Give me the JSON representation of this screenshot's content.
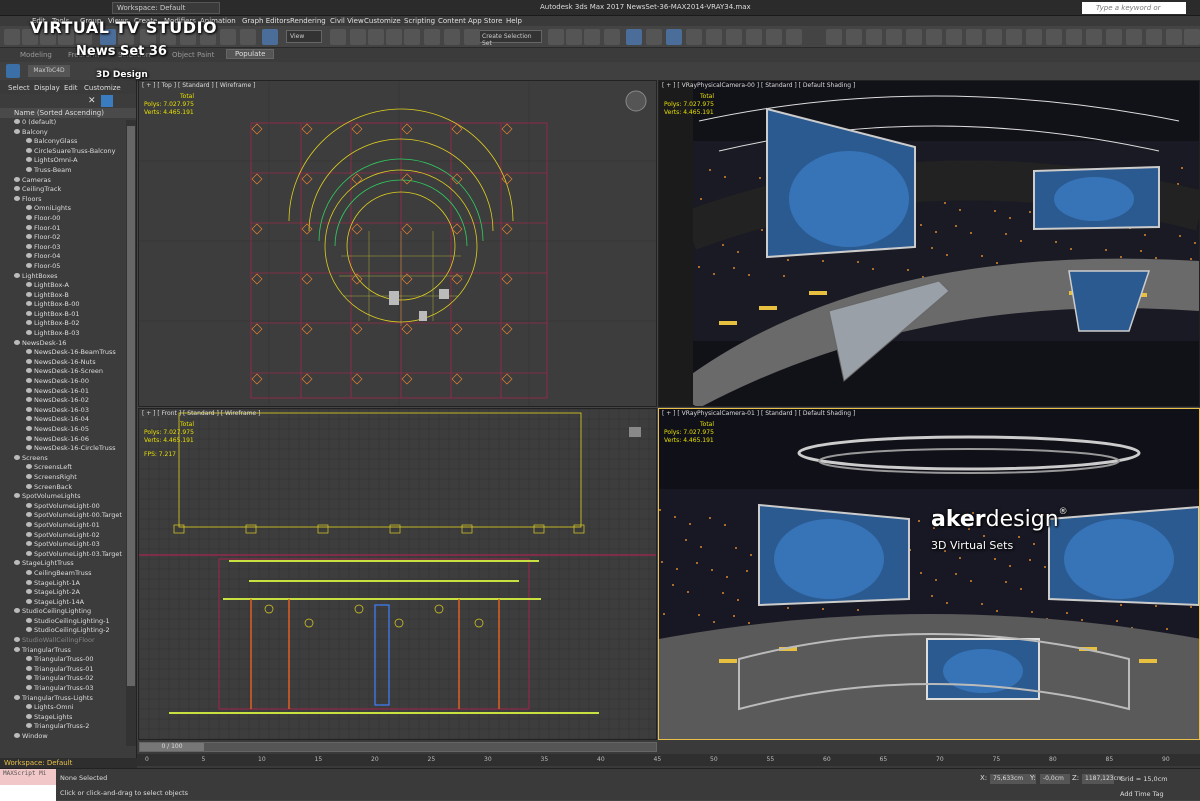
{
  "window": {
    "app_title": "Autodesk 3ds Max 2017      NewsSet-36-MAX2014-VRAY34.max",
    "workspace": "Workspace: Default",
    "search_placeholder": "Type a keyword or phrase"
  },
  "menu": [
    "Edit",
    "Tools",
    "Group",
    "Views",
    "Create",
    "Modifiers",
    "Animation",
    "Graph Editors",
    "Rendering",
    "Civil View",
    "Customize",
    "Scripting",
    "Content",
    "App Store",
    "Help"
  ],
  "toolbar": {
    "view_select": "View",
    "selection_set": "Create Selection Set"
  },
  "ribbon": {
    "tabs": [
      "Modeling",
      "Freeform",
      "Selection",
      "Object Paint",
      "Populate"
    ]
  },
  "maxtoc4d": "MaxToC4D",
  "brand": {
    "line1": "VIRTUAL TV STUDIO",
    "line2": "News Set 36",
    "line3": "3D Design",
    "logo_a": "aker",
    "logo_b": "design",
    "logo_mark": "®",
    "logo_sub": "3D Virtual Sets"
  },
  "scene_explorer": {
    "menu": [
      "Select",
      "Display",
      "Edit",
      "Customize"
    ],
    "close_glyph": "✕",
    "header": "Name (Sorted Ascending)",
    "items": [
      {
        "label": "0 (default)",
        "level": 1
      },
      {
        "label": "Balcony",
        "level": 1
      },
      {
        "label": "BalconyGlass",
        "level": 2
      },
      {
        "label": "CircleSuareTruss-Balcony",
        "level": 2
      },
      {
        "label": "LightsOmni-A",
        "level": 2
      },
      {
        "label": "Truss-Beam",
        "level": 2
      },
      {
        "label": "Cameras",
        "level": 1
      },
      {
        "label": "CeilingTrack",
        "level": 1
      },
      {
        "label": "Floors",
        "level": 1
      },
      {
        "label": "OmniLights",
        "level": 2
      },
      {
        "label": "Floor-00",
        "level": 2
      },
      {
        "label": "Floor-01",
        "level": 2
      },
      {
        "label": "Floor-02",
        "level": 2
      },
      {
        "label": "Floor-03",
        "level": 2
      },
      {
        "label": "Floor-04",
        "level": 2
      },
      {
        "label": "Floor-05",
        "level": 2
      },
      {
        "label": "LightBoxes",
        "level": 1
      },
      {
        "label": "LightBox-A",
        "level": 2
      },
      {
        "label": "LightBox-B",
        "level": 2
      },
      {
        "label": "LightBox-B-00",
        "level": 2
      },
      {
        "label": "LightBox-B-01",
        "level": 2
      },
      {
        "label": "LightBox-B-02",
        "level": 2
      },
      {
        "label": "LightBox-B-03",
        "level": 2
      },
      {
        "label": "NewsDesk-16",
        "level": 1
      },
      {
        "label": "NewsDesk-16-BeamTruss",
        "level": 2
      },
      {
        "label": "NewsDesk-16-Nuts",
        "level": 2
      },
      {
        "label": "NewsDesk-16-Screen",
        "level": 2
      },
      {
        "label": "NewsDesk-16-00",
        "level": 2
      },
      {
        "label": "NewsDesk-16-01",
        "level": 2
      },
      {
        "label": "NewsDesk-16-02",
        "level": 2
      },
      {
        "label": "NewsDesk-16-03",
        "level": 2
      },
      {
        "label": "NewsDesk-16-04",
        "level": 2
      },
      {
        "label": "NewsDesk-16-05",
        "level": 2
      },
      {
        "label": "NewsDesk-16-06",
        "level": 2
      },
      {
        "label": "NewsDesk-16-CircleTruss",
        "level": 2
      },
      {
        "label": "Screens",
        "level": 1
      },
      {
        "label": "ScreensLeft",
        "level": 2
      },
      {
        "label": "ScreensRight",
        "level": 2
      },
      {
        "label": "ScreenBack",
        "level": 2
      },
      {
        "label": "SpotVolumeLights",
        "level": 1
      },
      {
        "label": "SpotVolumeLight-00",
        "level": 2
      },
      {
        "label": "SpotVolumeLight-00.Target",
        "level": 2
      },
      {
        "label": "SpotVolumeLight-01",
        "level": 2
      },
      {
        "label": "SpotVolumeLight-02",
        "level": 2
      },
      {
        "label": "SpotVolumeLight-03",
        "level": 2
      },
      {
        "label": "SpotVolumeLight-03.Target",
        "level": 2
      },
      {
        "label": "StageLightTruss",
        "level": 1
      },
      {
        "label": "CeilingBeamTruss",
        "level": 2
      },
      {
        "label": "StageLight-1A",
        "level": 2
      },
      {
        "label": "StageLight-2A",
        "level": 2
      },
      {
        "label": "StageLight-14A",
        "level": 2
      },
      {
        "label": "StudioCeilingLighting",
        "level": 1
      },
      {
        "label": "StudioCeilingLighting-1",
        "level": 2
      },
      {
        "label": "StudioCeilingLighting-2",
        "level": 2
      },
      {
        "label": "StudioWallCeilingFloor",
        "level": 1,
        "dim": true
      },
      {
        "label": "TriangularTruss",
        "level": 1
      },
      {
        "label": "TriangularTruss-00",
        "level": 2
      },
      {
        "label": "TriangularTruss-01",
        "level": 2
      },
      {
        "label": "TriangularTruss-02",
        "level": 2
      },
      {
        "label": "TriangularTruss-03",
        "level": 2
      },
      {
        "label": "TriangularTruss-Lights",
        "level": 1
      },
      {
        "label": "Lights-Omni",
        "level": 2
      },
      {
        "label": "StageLights",
        "level": 2
      },
      {
        "label": "TriangularTruss-2",
        "level": 2
      },
      {
        "label": "Window",
        "level": 1
      }
    ],
    "workspace": "Workspace: Default"
  },
  "viewports": {
    "top": {
      "label": "[ + ] [ Top ] [ Standard ] [ Wireframe ]",
      "total": "Total",
      "polys": "Polys:   7.027.975",
      "verts": "Verts:   4.465.191"
    },
    "cam0": {
      "label": "[ + ] [ VRayPhysicalCamera-00 ] [ Standard ] [ Default Shading ]",
      "total": "Total",
      "polys": "Polys:   7.027.975",
      "verts": "Verts:   4.465.191"
    },
    "front": {
      "label": "[ + ] [ Front ] [ Standard ] [ Wireframe ]",
      "total": "Total",
      "polys": "Polys:   7.027.975",
      "verts": "Verts:   4.465.191",
      "fps": "FPS:     7.217"
    },
    "cam1": {
      "label": "[ + ] [ VRayPhysicalCamera-01 ] [ Standard ] [ Default Shading ]",
      "total": "Total",
      "polys": "Polys:   7.027.975",
      "verts": "Verts:   4.465.191"
    }
  },
  "timeline": {
    "frame": "0 / 100",
    "ticks": [
      "0",
      "5",
      "10",
      "15",
      "20",
      "25",
      "30",
      "35",
      "40",
      "45",
      "50",
      "55",
      "60",
      "65",
      "70",
      "75",
      "80",
      "85",
      "90"
    ]
  },
  "status": {
    "maxscript": "MAXScript Mi",
    "selection": "None Selected",
    "prompt": "Click or click-and-drag to select objects",
    "x_label": "X:",
    "x_val": "75,633cm",
    "y_label": "Y:",
    "y_val": "-0,0cm",
    "z_label": "Z:",
    "z_val": "1187,123cm",
    "grid": "Grid = 15,0cm",
    "add_time_tag": "Add Time Tag"
  }
}
